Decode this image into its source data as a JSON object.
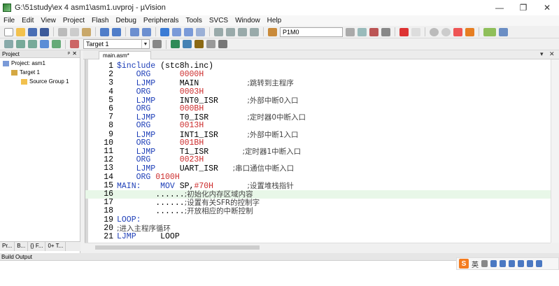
{
  "window": {
    "title": "G:\\51study\\ex 4 asm1\\asm1.uvproj - µVision",
    "minimize": "—",
    "maximize": "❐",
    "close": "✕"
  },
  "menu": [
    "File",
    "Edit",
    "View",
    "Project",
    "Flash",
    "Debug",
    "Peripherals",
    "Tools",
    "SVCS",
    "Window",
    "Help"
  ],
  "toolbar1": {
    "symbol_combo": "P1M0"
  },
  "toolbar2": {
    "target_combo": "Target 1"
  },
  "project_panel": {
    "title": "Project",
    "pin": "ᵖ",
    "close": "✕",
    "tree": {
      "root": "Project: asm1",
      "target": "Target 1",
      "group": "Source Group 1"
    },
    "tabs": [
      "Pr...",
      "B...",
      "{} F...",
      "0+ T..."
    ]
  },
  "editor": {
    "tab_label": "main.asm*",
    "dropdown": "▾",
    "close": "✕",
    "lines": [
      {
        "n": "1",
        "parts": [
          {
            "t": "$include",
            "c": "inc"
          },
          {
            "t": " (stc8h.inc)",
            "c": "op"
          }
        ]
      },
      {
        "n": "2",
        "parts": [
          {
            "t": "    ORG      ",
            "c": "kw"
          },
          {
            "t": "0000H",
            "c": "num"
          }
        ]
      },
      {
        "n": "3",
        "parts": [
          {
            "t": "    LJMP     ",
            "c": "kw"
          },
          {
            "t": "MAIN          ",
            "c": "op"
          },
          {
            "t": ";跳转到主程序",
            "c": "cmt"
          }
        ]
      },
      {
        "n": "4",
        "parts": [
          {
            "t": "    ORG      ",
            "c": "kw"
          },
          {
            "t": "0003H",
            "c": "num"
          }
        ]
      },
      {
        "n": "5",
        "parts": [
          {
            "t": "    LJMP     ",
            "c": "kw"
          },
          {
            "t": "INT0_ISR      ",
            "c": "op"
          },
          {
            "t": ";外部中断0入口",
            "c": "cmt"
          }
        ]
      },
      {
        "n": "6",
        "parts": [
          {
            "t": "    ORG      ",
            "c": "kw"
          },
          {
            "t": "000BH",
            "c": "num"
          }
        ]
      },
      {
        "n": "7",
        "parts": [
          {
            "t": "    LJMP     ",
            "c": "kw"
          },
          {
            "t": "T0_ISR        ",
            "c": "op"
          },
          {
            "t": ";定时器0中断入口",
            "c": "cmt"
          }
        ]
      },
      {
        "n": "8",
        "parts": [
          {
            "t": "    ORG      ",
            "c": "kw"
          },
          {
            "t": "0013H",
            "c": "num"
          }
        ]
      },
      {
        "n": "9",
        "parts": [
          {
            "t": "    LJMP     ",
            "c": "kw"
          },
          {
            "t": "INT1_ISR      ",
            "c": "op"
          },
          {
            "t": ";外部中断1入口",
            "c": "cmt"
          }
        ]
      },
      {
        "n": "10",
        "parts": [
          {
            "t": "    ORG      ",
            "c": "kw"
          },
          {
            "t": "001BH",
            "c": "num"
          }
        ]
      },
      {
        "n": "11",
        "parts": [
          {
            "t": "    LJMP     ",
            "c": "kw"
          },
          {
            "t": "T1_ISR       ",
            "c": "op"
          },
          {
            "t": ";定时器1中断入口",
            "c": "cmt"
          }
        ]
      },
      {
        "n": "12",
        "parts": [
          {
            "t": "    ORG      ",
            "c": "kw"
          },
          {
            "t": "0023H",
            "c": "num"
          }
        ]
      },
      {
        "n": "13",
        "parts": [
          {
            "t": "    LJMP     ",
            "c": "kw"
          },
          {
            "t": "UART_ISR   ",
            "c": "op"
          },
          {
            "t": ";串口通信中断入口",
            "c": "cmt"
          }
        ]
      },
      {
        "n": "14",
        "parts": [
          {
            "t": "    ORG ",
            "c": "kw"
          },
          {
            "t": "0100H",
            "c": "num"
          }
        ]
      },
      {
        "n": "15",
        "parts": [
          {
            "t": "MAIN:",
            "c": "lbl"
          },
          {
            "t": "    MOV ",
            "c": "kw"
          },
          {
            "t": "SP,",
            "c": "op"
          },
          {
            "t": "#70H",
            "c": "num"
          },
          {
            "t": "       ",
            "c": "op"
          },
          {
            "t": ";设置堆栈指针",
            "c": "cmt"
          }
        ]
      },
      {
        "n": "16",
        "parts": [
          {
            "t": "        ......",
            "c": "op"
          },
          {
            "t": ";初始化内存区域内容",
            "c": "cmt"
          }
        ]
      },
      {
        "n": "17",
        "parts": [
          {
            "t": "        ......",
            "c": "op"
          },
          {
            "t": ";设置有关SFR的控制字",
            "c": "cmt"
          }
        ]
      },
      {
        "n": "18",
        "parts": [
          {
            "t": "        ......",
            "c": "op"
          },
          {
            "t": ";开放相应的中断控制",
            "c": "cmt"
          }
        ]
      },
      {
        "n": "19",
        "parts": [
          {
            "t": "LOOP:",
            "c": "lbl"
          }
        ]
      },
      {
        "n": "20",
        "parts": [
          {
            "t": ";进入主程序循环",
            "c": "cmt"
          }
        ]
      },
      {
        "n": "21",
        "parts": [
          {
            "t": "LJMP",
            "c": "kw"
          },
          {
            "t": "     LOOP",
            "c": "op"
          }
        ]
      }
    ]
  },
  "build_output": {
    "title": "Build Output"
  },
  "ime": {
    "logo": "S",
    "lang": "英"
  }
}
